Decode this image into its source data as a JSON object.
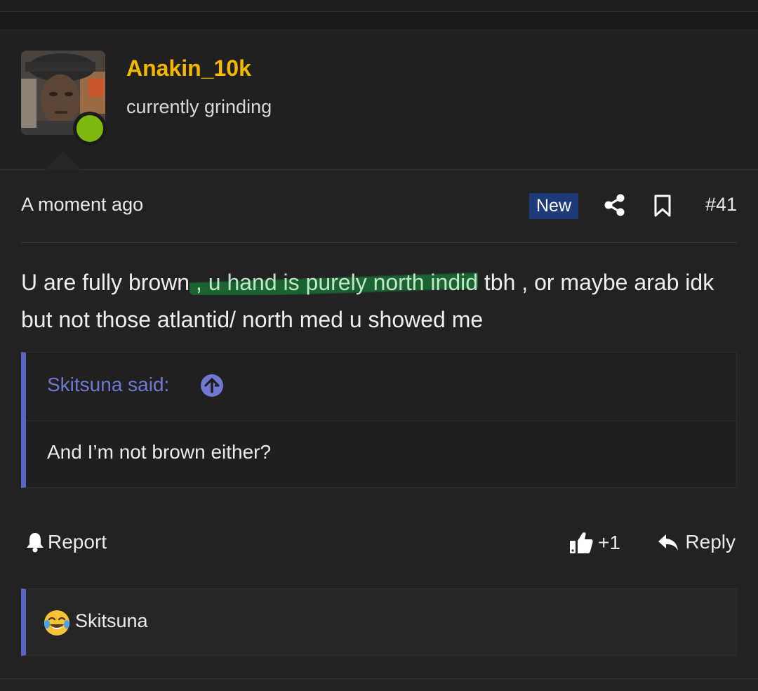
{
  "user": {
    "name": "Anakin_10k",
    "title": "currently grinding",
    "online": true
  },
  "post": {
    "timestamp": "A moment ago",
    "badge": "New",
    "number": "#41",
    "message_before": "U are fully brown",
    "message_highlight": " , u hand is purely north indid",
    "message_after": " tbh , or maybe arab idk but not those atlantid/ north med u showed me"
  },
  "quote": {
    "author": "Skitsuna said:",
    "body": "And I’m not brown either?"
  },
  "actions": {
    "report": "Report",
    "like_count": "+1",
    "reply": "Reply"
  },
  "reactions": {
    "emoji": "joy-emoji",
    "users": "Skitsuna"
  },
  "colors": {
    "username": "#f5b800",
    "online": "#7fb80e",
    "badge_bg": "#1f3a78",
    "quote_accent": "#5a64c4",
    "highlight": "#1a6e34"
  }
}
